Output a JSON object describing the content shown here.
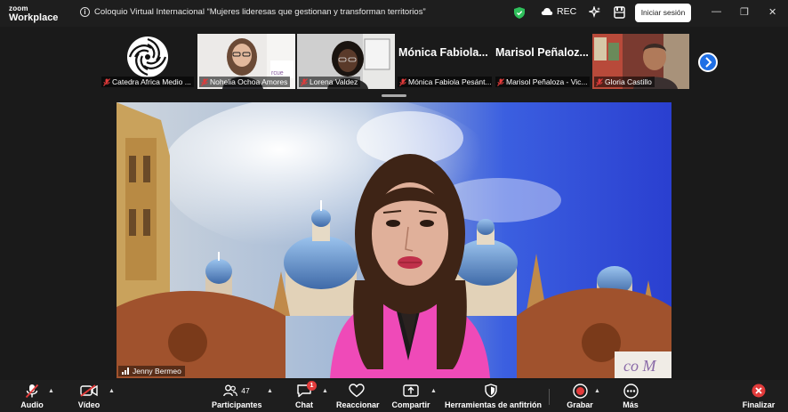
{
  "app": {
    "brand_small": "zoom",
    "brand_big": "Workplace"
  },
  "meeting": {
    "title": "Coloquio Virtual Internacional “Mujeres lideresas que gestionan y transforman territorios”"
  },
  "titlebar": {
    "rec_label": "REC",
    "signin_label": "Iniciar sesión",
    "minimize": "—",
    "restore": "❐",
    "close": "✕"
  },
  "participants_strip": [
    {
      "name": "Catedra Africa Medio ..."
    },
    {
      "name": "Nohelia Ochoa Amores"
    },
    {
      "name": "Lorena Valdez"
    },
    {
      "name": "Mónica Fabiola Pesánt...",
      "display": "Mónica Fabiola..."
    },
    {
      "name": "Marisol Peñaloza - Vic...",
      "display": "Marisol Peñaloz..."
    },
    {
      "name": "Gloria Castillo"
    }
  ],
  "main_video": {
    "speaker": "Jenny Bermeo"
  },
  "toolbar": {
    "audio": "Audio",
    "video": "Vídeo",
    "participants": "Participantes",
    "participants_count": "47",
    "chat": "Chat",
    "chat_badge": "1",
    "react": "Reaccionar",
    "share": "Compartir",
    "host_tools": "Herramientas de anfitrión",
    "record": "Grabar",
    "more": "Más",
    "end": "Finalizar"
  },
  "colors": {
    "accent_blue": "#1f6fe5",
    "record_red": "#e23b3b",
    "shield_green": "#2fbf5b"
  }
}
